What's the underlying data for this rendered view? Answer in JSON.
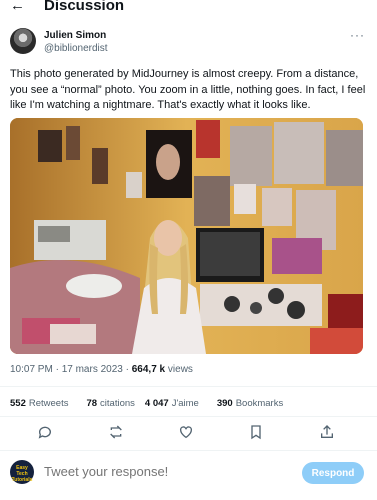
{
  "header": {
    "back_icon": "arrow-left-icon",
    "title": "Discussion"
  },
  "author": {
    "name": "Julien Simon",
    "handle": "@biblionerdist",
    "more_icon": "more-horizontal-icon"
  },
  "tweet": {
    "text": "This photo generated by MidJourney is almost creepy.  From a distance, you see a “normal” photo.  You zoom in a little, nothing goes.  In fact, I feel like I'm watching a nightmare.  That's exactly what it looks like.",
    "time": "10:07 PM",
    "date": "17 mars 2023",
    "views_count": "664,7 k",
    "views_label": "views"
  },
  "stats": {
    "retweets_count": "552",
    "retweets_label": "Retweets",
    "quotes_count": "78",
    "quotes_label": "citations",
    "likes_count": "4 047",
    "likes_label": "J'aime",
    "bookmarks_count": "390",
    "bookmarks_label": "Bookmarks"
  },
  "actions": [
    "reply-icon",
    "retweet-icon",
    "like-icon",
    "bookmark-icon",
    "share-icon"
  ],
  "reply": {
    "avatar_text": "Easy Tech Tutorials",
    "placeholder": "Tweet your response!",
    "button_label": "Respond"
  },
  "colors": {
    "accent": "#1d9bf0",
    "button_disabled": "#8ecdf8",
    "muted_text": "#536471"
  }
}
